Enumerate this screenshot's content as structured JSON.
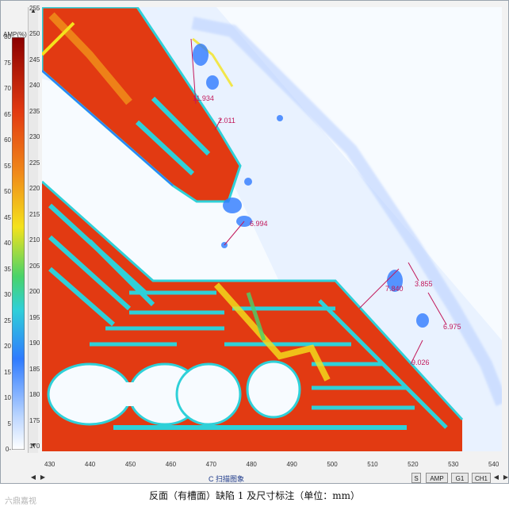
{
  "colorbar": {
    "title": "AMP(%)",
    "labels": [
      "80",
      "75",
      "70",
      "65",
      "60",
      "55",
      "50",
      "45",
      "40",
      "35",
      "30",
      "25",
      "20",
      "15",
      "10",
      "5",
      "0-"
    ]
  },
  "y_axis": {
    "labels": [
      "255",
      "250",
      "245",
      "240",
      "235",
      "230",
      "225",
      "220",
      "215",
      "210",
      "205",
      "200",
      "195",
      "190",
      "185",
      "180",
      "175",
      "170"
    ]
  },
  "x_axis": {
    "labels": [
      "430",
      "440",
      "450",
      "460",
      "470",
      "480",
      "490",
      "500",
      "510",
      "520",
      "530",
      "540"
    ]
  },
  "annotations": [
    "11.934",
    "2.011",
    "6.994",
    "7.840",
    "3.855",
    "6.975",
    "9.026"
  ],
  "statusbar": {
    "title": "C 扫描图象",
    "buttons": [
      "S",
      "AMP",
      "G1",
      "CH1"
    ]
  },
  "caption": "反面（有槽面）缺陷 1 及尺寸标注（单位：mm）",
  "watermark": "六鼎嘉视",
  "colors": {
    "red": "#e23a12",
    "orange": "#f08a1a",
    "yellow": "#f4e21c",
    "green": "#49d36a",
    "cyan": "#2fd0d8",
    "blue": "#2f7bff",
    "lightblue": "#dce9ff",
    "annotation": "#c2185b"
  }
}
